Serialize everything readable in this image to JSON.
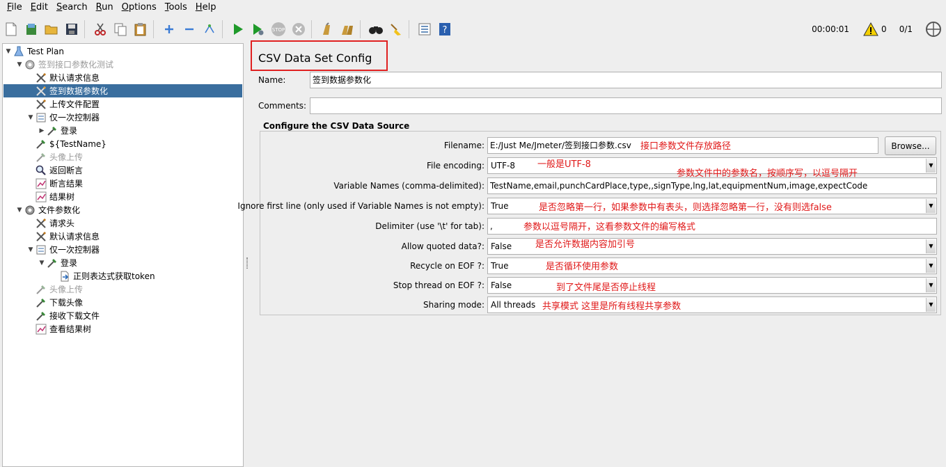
{
  "menu": [
    "File",
    "Edit",
    "Search",
    "Run",
    "Options",
    "Tools",
    "Help"
  ],
  "menu_underline": [
    "F",
    "E",
    "S",
    "R",
    "O",
    "T",
    "H"
  ],
  "menu_rest": [
    "ile",
    "dit",
    "earch",
    "un",
    "ptions",
    "ools",
    "elp"
  ],
  "status": {
    "elapsed": "00:00:01",
    "warnings": "0",
    "threads": "0/1"
  },
  "tree": {
    "n0": "Test Plan",
    "n1": "签到接口参数化测试",
    "n2": "默认请求信息",
    "n3": "签到数据参数化",
    "n4": "上传文件配置",
    "n5": "仅一次控制器",
    "n6": "登录",
    "n7": "${TestName}",
    "n8": "头像上传",
    "n9": "返回断言",
    "n10": "断言结果",
    "n11": "结果树",
    "n12": "文件参数化",
    "n13": "请求头",
    "n14": "默认请求信息",
    "n15": "仅一次控制器",
    "n16": "登录",
    "n17": "正则表达式获取token",
    "n18": "头像上传",
    "n19": "下载头像",
    "n20": "接收下载文件",
    "n21": "查看结果树"
  },
  "panel": {
    "title": "CSV Data Set Config",
    "name_label": "Name:",
    "name_value": "签到数据参数化",
    "comments_label": "Comments:",
    "comments_value": "",
    "group_title": "Configure the CSV Data Source",
    "filename_label": "Filename:",
    "filename_value": "E:/Just Me/Jmeter/签到接口参数.csv",
    "browse_label": "Browse...",
    "encoding_label": "File encoding:",
    "encoding_value": "UTF-8",
    "varnames_label": "Variable Names (comma-delimited):",
    "varnames_value": "TestName,email,punchCardPlace,type,,signType,lng,lat,equipmentNum,image,expectCode",
    "ignore_label": "Ignore first line (only used if Variable Names is not empty):",
    "ignore_value": "True",
    "delimiter_label": "Delimiter (use '\\t' for tab):",
    "delimiter_value": ",",
    "quoted_label": "Allow quoted data?:",
    "quoted_value": "False",
    "recycle_label": "Recycle on EOF ?:",
    "recycle_value": "True",
    "stop_label": "Stop thread on EOF ?:",
    "stop_value": "False",
    "sharing_label": "Sharing mode:",
    "sharing_value": "All threads"
  },
  "notes": {
    "filename": "接口参数文件存放路径",
    "encoding": "一般是UTF-8",
    "varnames": "参数文件中的参数名，按顺序写，以逗号隔开",
    "ignore": "是否忽略第一行，如果参数中有表头，则选择忽略第一行，没有则选false",
    "delimiter": "参数以逗号隔开，这看参数文件的编写格式",
    "quoted": "是否允许数据内容加引号",
    "recycle": "是否循环使用参数",
    "stop": "到了文件尾是否停止线程",
    "sharing": "共享模式 这里是所有线程共享参数"
  },
  "colors": {
    "selection": "#3a6e9e",
    "annotation": "#e01818",
    "highlight_box": "#e02020"
  }
}
